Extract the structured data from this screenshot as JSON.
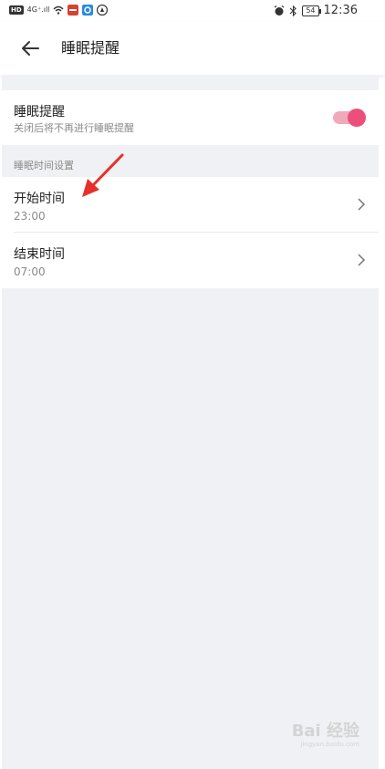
{
  "status_bar": {
    "left_badges": [
      "HD",
      "4G⁺.ıll"
    ],
    "battery": "54",
    "time": "12:36"
  },
  "header": {
    "back_icon": "arrow-left-icon",
    "title": "睡眠提醒"
  },
  "reminder": {
    "title": "睡眠提醒",
    "subtitle": "关闭后将不再进行睡眠提醒",
    "toggle_on": true,
    "accent_color": "#ec4f7b"
  },
  "section": {
    "title": "睡眠时间设置"
  },
  "settings": {
    "start": {
      "label": "开始时间",
      "value": "23:00"
    },
    "end": {
      "label": "结束时间",
      "value": "07:00"
    }
  },
  "watermark": {
    "text": "Bai 经验",
    "sub": "jingyan.baidu.com"
  }
}
